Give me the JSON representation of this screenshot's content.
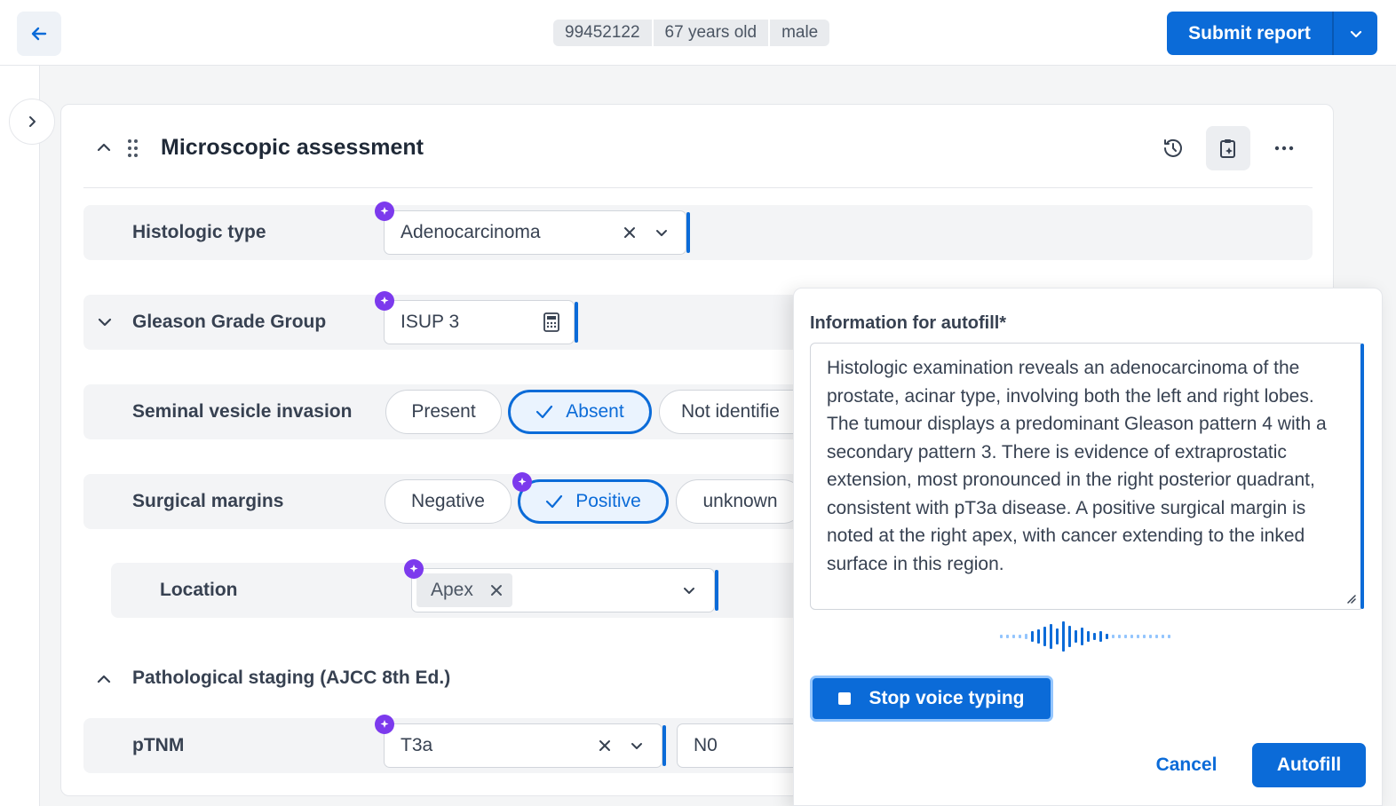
{
  "header": {
    "patient_id": "99452122",
    "age": "67 years old",
    "sex": "male",
    "submit_label": "Submit report"
  },
  "section": {
    "title": "Microscopic assessment"
  },
  "fields": {
    "histologic_type": {
      "label": "Histologic type",
      "value": "Adenocarcinoma"
    },
    "gleason": {
      "label": "Gleason Grade Group",
      "value": "ISUP 3"
    },
    "seminal": {
      "label": "Seminal vesicle invasion",
      "options": [
        "Present",
        "Absent",
        "Not identifie"
      ],
      "selected": "Absent"
    },
    "margins": {
      "label": "Surgical margins",
      "options": [
        "Negative",
        "Positive",
        "unknown"
      ],
      "selected": "Positive"
    },
    "location": {
      "label": "Location",
      "tag": "Apex"
    },
    "staging": {
      "title": "Pathological staging (AJCC 8th Ed.)"
    },
    "ptnm": {
      "label": "pTNM",
      "t_value": "T3a",
      "n_value": "N0"
    }
  },
  "popover": {
    "label": "Information for autofill*",
    "text": "Histologic examination reveals an adenocarcinoma of the prostate, acinar type, involving both the left and right lobes. The tumour displays a predominant Gleason pattern 4 with a secondary pattern 3. There is evidence of extraprostatic extension, most pronounced in the right posterior quadrant, consistent with pT3a disease. A positive surgical margin is noted at the right apex, with cancer extending to the inked surface in this region.",
    "stop_label": "Stop voice typing",
    "cancel_label": "Cancel",
    "autofill_label": "Autofill"
  },
  "colors": {
    "primary": "#0b6bd8",
    "ai_badge": "#7c3aed"
  }
}
